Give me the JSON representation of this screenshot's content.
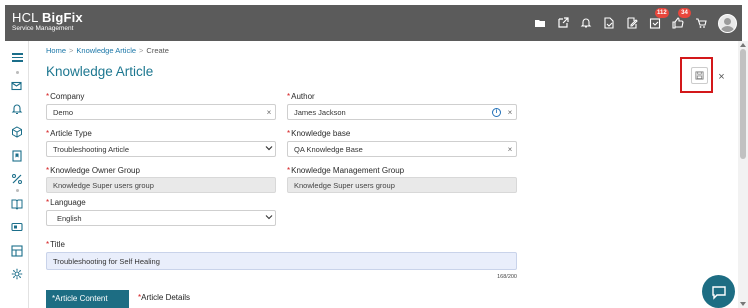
{
  "brand": {
    "name_light": "HCL ",
    "name_bold": "BigFix",
    "subtitle": "Service Management"
  },
  "topbar": {
    "icons": [
      "folder-icon",
      "external-link-icon",
      "bell-icon",
      "document-icon",
      "edit-icon",
      "approvals-icon",
      "thumbs-up-icon",
      "cart-icon",
      "avatar"
    ],
    "approvals_badge": "112",
    "likes_badge": "34"
  },
  "sidebar": {
    "icons": [
      "menu-icon",
      "mail-settings-icon",
      "bell-icon",
      "cube-icon",
      "bookmark-icon",
      "percent-icon",
      "book-icon",
      "ticket-icon",
      "layout-icon",
      "gear-icon"
    ]
  },
  "breadcrumb": {
    "home": "Home",
    "section": "Knowledge Article",
    "current": "Create",
    "separator": ">"
  },
  "page": {
    "title": "Knowledge Article"
  },
  "form": {
    "required_mark": "*",
    "company": {
      "label": "Company",
      "value": "Demo",
      "clear": "×"
    },
    "author": {
      "label": "Author",
      "value": "James Jackson",
      "info": "i",
      "clear": "×"
    },
    "article_type": {
      "label": "Article Type",
      "value": "Troubleshooting Article"
    },
    "knowledge_base": {
      "label": "Knowledge base",
      "value": "QA Knowledge Base",
      "clear": "×"
    },
    "owner_group": {
      "label": "Knowledge Owner Group",
      "value": "Knowledge Super users group"
    },
    "management_group": {
      "label": "Knowledge Management Group",
      "value": "Knowledge Super users group"
    },
    "language": {
      "label": "Language",
      "value": "English"
    },
    "title": {
      "label": "Title",
      "value": "Troubleshooting for Self Healing",
      "counter": "168/200"
    }
  },
  "tabs": {
    "article_content": "Article Content",
    "article_details": "Article Details"
  },
  "header_actions": {
    "close": "×"
  },
  "colors": {
    "topbar": "#5b5b5b",
    "accent": "#1d6d83",
    "required": "#d3181a",
    "highlight_box": "#d3181a"
  }
}
